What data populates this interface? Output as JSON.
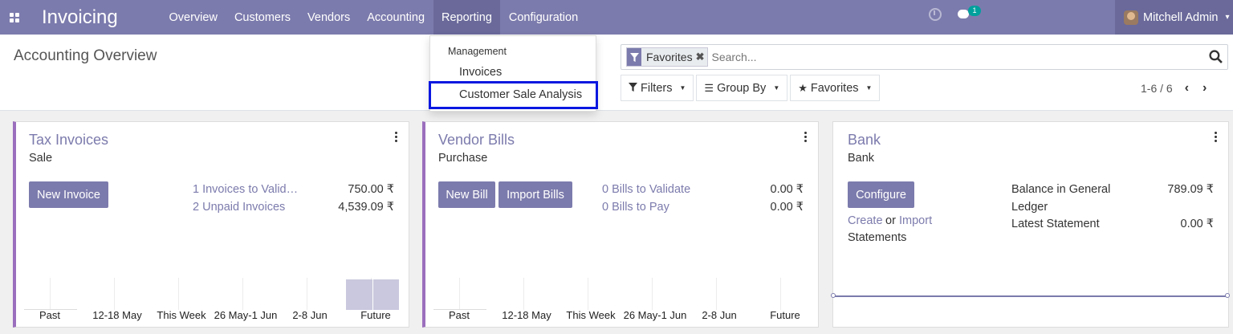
{
  "navbar": {
    "brand": "Invoicing",
    "menu": [
      "Overview",
      "Customers",
      "Vendors",
      "Accounting",
      "Reporting",
      "Configuration"
    ],
    "active_menu": "Reporting",
    "chat_badge": "1",
    "user_name": "Mitchell Admin"
  },
  "control_panel": {
    "title": "Accounting Overview",
    "search": {
      "facet_label": "Favorites",
      "placeholder": "Search..."
    },
    "filters_label": "Filters",
    "groupby_label": "Group By",
    "favorites_label": "Favorites",
    "pager": "1-6 / 6"
  },
  "reporting_dropdown": {
    "header": "Management",
    "items": [
      "Invoices",
      "Customer Sale Analysis"
    ],
    "highlighted_item": "Customer Sale Analysis"
  },
  "cards": {
    "sales": {
      "title": "Tax Invoices",
      "subtitle": "Sale",
      "button": "New Invoice",
      "lines": [
        {
          "label": "1 Invoices to Valid…",
          "amount": "750.00 ₹"
        },
        {
          "label": "2 Unpaid Invoices",
          "amount": "4,539.09 ₹"
        }
      ],
      "graph_labels": [
        "Past",
        "12-18 May",
        "This Week",
        "26 May-1 Jun",
        "2-8 Jun",
        "Future"
      ]
    },
    "purchase": {
      "title": "Vendor Bills",
      "subtitle": "Purchase",
      "buttons": [
        "New Bill",
        "Import Bills"
      ],
      "lines": [
        {
          "label": "0 Bills to Validate",
          "amount": "0.00 ₹"
        },
        {
          "label": "0 Bills to Pay",
          "amount": "0.00 ₹"
        }
      ],
      "graph_labels": [
        "Past",
        "12-18 May",
        "This Week",
        "26 May-1 Jun",
        "2-8 Jun",
        "Future"
      ]
    },
    "bank": {
      "title": "Bank",
      "subtitle": "Bank",
      "button": "Configure",
      "create_link": "Create",
      "or_text": "or",
      "import_link": "Import",
      "statements_text": "Statements",
      "balance_label_1": "Balance in General",
      "balance_label_2": "Ledger",
      "balance_amount": "789.09 ₹",
      "statement_label": "Latest Statement",
      "statement_amount": "0.00 ₹"
    }
  },
  "colors": {
    "navbar": "#7c7bad",
    "accent": "#7c7bad",
    "highlight_box": "#0a18e0"
  }
}
